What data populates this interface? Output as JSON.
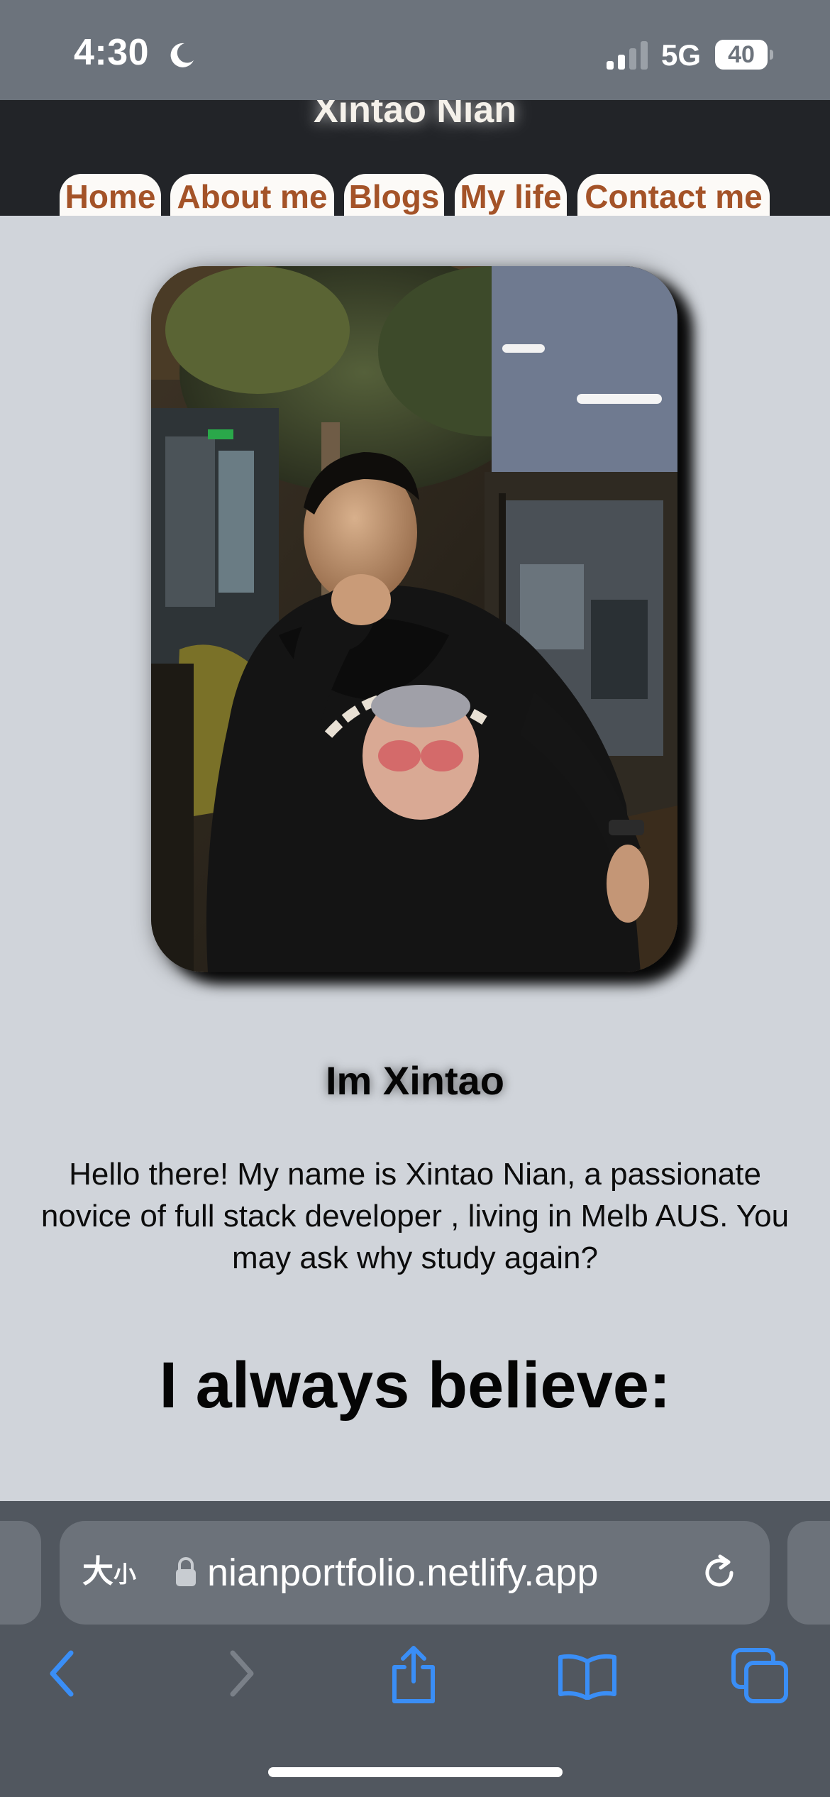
{
  "status_bar": {
    "time": "4:30",
    "network": "5G",
    "battery": "40",
    "icons": [
      "moon-icon",
      "signal-icon",
      "battery-icon"
    ]
  },
  "site": {
    "title": "Xintao Nian",
    "nav": [
      {
        "label": "Home"
      },
      {
        "label": "About me"
      },
      {
        "label": "Blogs"
      },
      {
        "label": "My life"
      },
      {
        "label": "Contact me"
      }
    ],
    "accent_color": "#a45328",
    "header_bg": "#222428",
    "page_bg": "#d0d4da"
  },
  "main": {
    "photo_alt": "profile-photo",
    "heading": "Im Xintao",
    "intro_lines": [
      "Hello there! My name is Xintao Nian, a passionate",
      "novice of full stack developer , living in Melb AUS. You",
      "may ask why study again?"
    ],
    "belief_heading": "I always believe:"
  },
  "browser": {
    "text_size_label": "大",
    "text_size_small": "小",
    "url": "nianportfolio.netlify.app",
    "toolbar": [
      "back-icon",
      "forward-icon",
      "share-icon",
      "bookmarks-icon",
      "tabs-icon"
    ],
    "accent_color": "#3a8ef6"
  }
}
